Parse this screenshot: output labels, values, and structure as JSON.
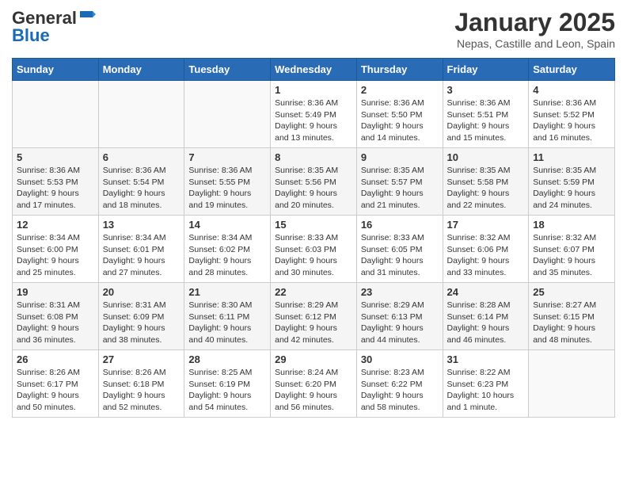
{
  "logo": {
    "line1": "General",
    "line2": "Blue"
  },
  "header": {
    "title": "January 2025",
    "subtitle": "Nepas, Castille and Leon, Spain"
  },
  "weekdays": [
    "Sunday",
    "Monday",
    "Tuesday",
    "Wednesday",
    "Thursday",
    "Friday",
    "Saturday"
  ],
  "weeks": [
    [
      {
        "day": "",
        "info": ""
      },
      {
        "day": "",
        "info": ""
      },
      {
        "day": "",
        "info": ""
      },
      {
        "day": "1",
        "info": "Sunrise: 8:36 AM\nSunset: 5:49 PM\nDaylight: 9 hours\nand 13 minutes."
      },
      {
        "day": "2",
        "info": "Sunrise: 8:36 AM\nSunset: 5:50 PM\nDaylight: 9 hours\nand 14 minutes."
      },
      {
        "day": "3",
        "info": "Sunrise: 8:36 AM\nSunset: 5:51 PM\nDaylight: 9 hours\nand 15 minutes."
      },
      {
        "day": "4",
        "info": "Sunrise: 8:36 AM\nSunset: 5:52 PM\nDaylight: 9 hours\nand 16 minutes."
      }
    ],
    [
      {
        "day": "5",
        "info": "Sunrise: 8:36 AM\nSunset: 5:53 PM\nDaylight: 9 hours\nand 17 minutes."
      },
      {
        "day": "6",
        "info": "Sunrise: 8:36 AM\nSunset: 5:54 PM\nDaylight: 9 hours\nand 18 minutes."
      },
      {
        "day": "7",
        "info": "Sunrise: 8:36 AM\nSunset: 5:55 PM\nDaylight: 9 hours\nand 19 minutes."
      },
      {
        "day": "8",
        "info": "Sunrise: 8:35 AM\nSunset: 5:56 PM\nDaylight: 9 hours\nand 20 minutes."
      },
      {
        "day": "9",
        "info": "Sunrise: 8:35 AM\nSunset: 5:57 PM\nDaylight: 9 hours\nand 21 minutes."
      },
      {
        "day": "10",
        "info": "Sunrise: 8:35 AM\nSunset: 5:58 PM\nDaylight: 9 hours\nand 22 minutes."
      },
      {
        "day": "11",
        "info": "Sunrise: 8:35 AM\nSunset: 5:59 PM\nDaylight: 9 hours\nand 24 minutes."
      }
    ],
    [
      {
        "day": "12",
        "info": "Sunrise: 8:34 AM\nSunset: 6:00 PM\nDaylight: 9 hours\nand 25 minutes."
      },
      {
        "day": "13",
        "info": "Sunrise: 8:34 AM\nSunset: 6:01 PM\nDaylight: 9 hours\nand 27 minutes."
      },
      {
        "day": "14",
        "info": "Sunrise: 8:34 AM\nSunset: 6:02 PM\nDaylight: 9 hours\nand 28 minutes."
      },
      {
        "day": "15",
        "info": "Sunrise: 8:33 AM\nSunset: 6:03 PM\nDaylight: 9 hours\nand 30 minutes."
      },
      {
        "day": "16",
        "info": "Sunrise: 8:33 AM\nSunset: 6:05 PM\nDaylight: 9 hours\nand 31 minutes."
      },
      {
        "day": "17",
        "info": "Sunrise: 8:32 AM\nSunset: 6:06 PM\nDaylight: 9 hours\nand 33 minutes."
      },
      {
        "day": "18",
        "info": "Sunrise: 8:32 AM\nSunset: 6:07 PM\nDaylight: 9 hours\nand 35 minutes."
      }
    ],
    [
      {
        "day": "19",
        "info": "Sunrise: 8:31 AM\nSunset: 6:08 PM\nDaylight: 9 hours\nand 36 minutes."
      },
      {
        "day": "20",
        "info": "Sunrise: 8:31 AM\nSunset: 6:09 PM\nDaylight: 9 hours\nand 38 minutes."
      },
      {
        "day": "21",
        "info": "Sunrise: 8:30 AM\nSunset: 6:11 PM\nDaylight: 9 hours\nand 40 minutes."
      },
      {
        "day": "22",
        "info": "Sunrise: 8:29 AM\nSunset: 6:12 PM\nDaylight: 9 hours\nand 42 minutes."
      },
      {
        "day": "23",
        "info": "Sunrise: 8:29 AM\nSunset: 6:13 PM\nDaylight: 9 hours\nand 44 minutes."
      },
      {
        "day": "24",
        "info": "Sunrise: 8:28 AM\nSunset: 6:14 PM\nDaylight: 9 hours\nand 46 minutes."
      },
      {
        "day": "25",
        "info": "Sunrise: 8:27 AM\nSunset: 6:15 PM\nDaylight: 9 hours\nand 48 minutes."
      }
    ],
    [
      {
        "day": "26",
        "info": "Sunrise: 8:26 AM\nSunset: 6:17 PM\nDaylight: 9 hours\nand 50 minutes."
      },
      {
        "day": "27",
        "info": "Sunrise: 8:26 AM\nSunset: 6:18 PM\nDaylight: 9 hours\nand 52 minutes."
      },
      {
        "day": "28",
        "info": "Sunrise: 8:25 AM\nSunset: 6:19 PM\nDaylight: 9 hours\nand 54 minutes."
      },
      {
        "day": "29",
        "info": "Sunrise: 8:24 AM\nSunset: 6:20 PM\nDaylight: 9 hours\nand 56 minutes."
      },
      {
        "day": "30",
        "info": "Sunrise: 8:23 AM\nSunset: 6:22 PM\nDaylight: 9 hours\nand 58 minutes."
      },
      {
        "day": "31",
        "info": "Sunrise: 8:22 AM\nSunset: 6:23 PM\nDaylight: 10 hours\nand 1 minute."
      },
      {
        "day": "",
        "info": ""
      }
    ]
  ]
}
